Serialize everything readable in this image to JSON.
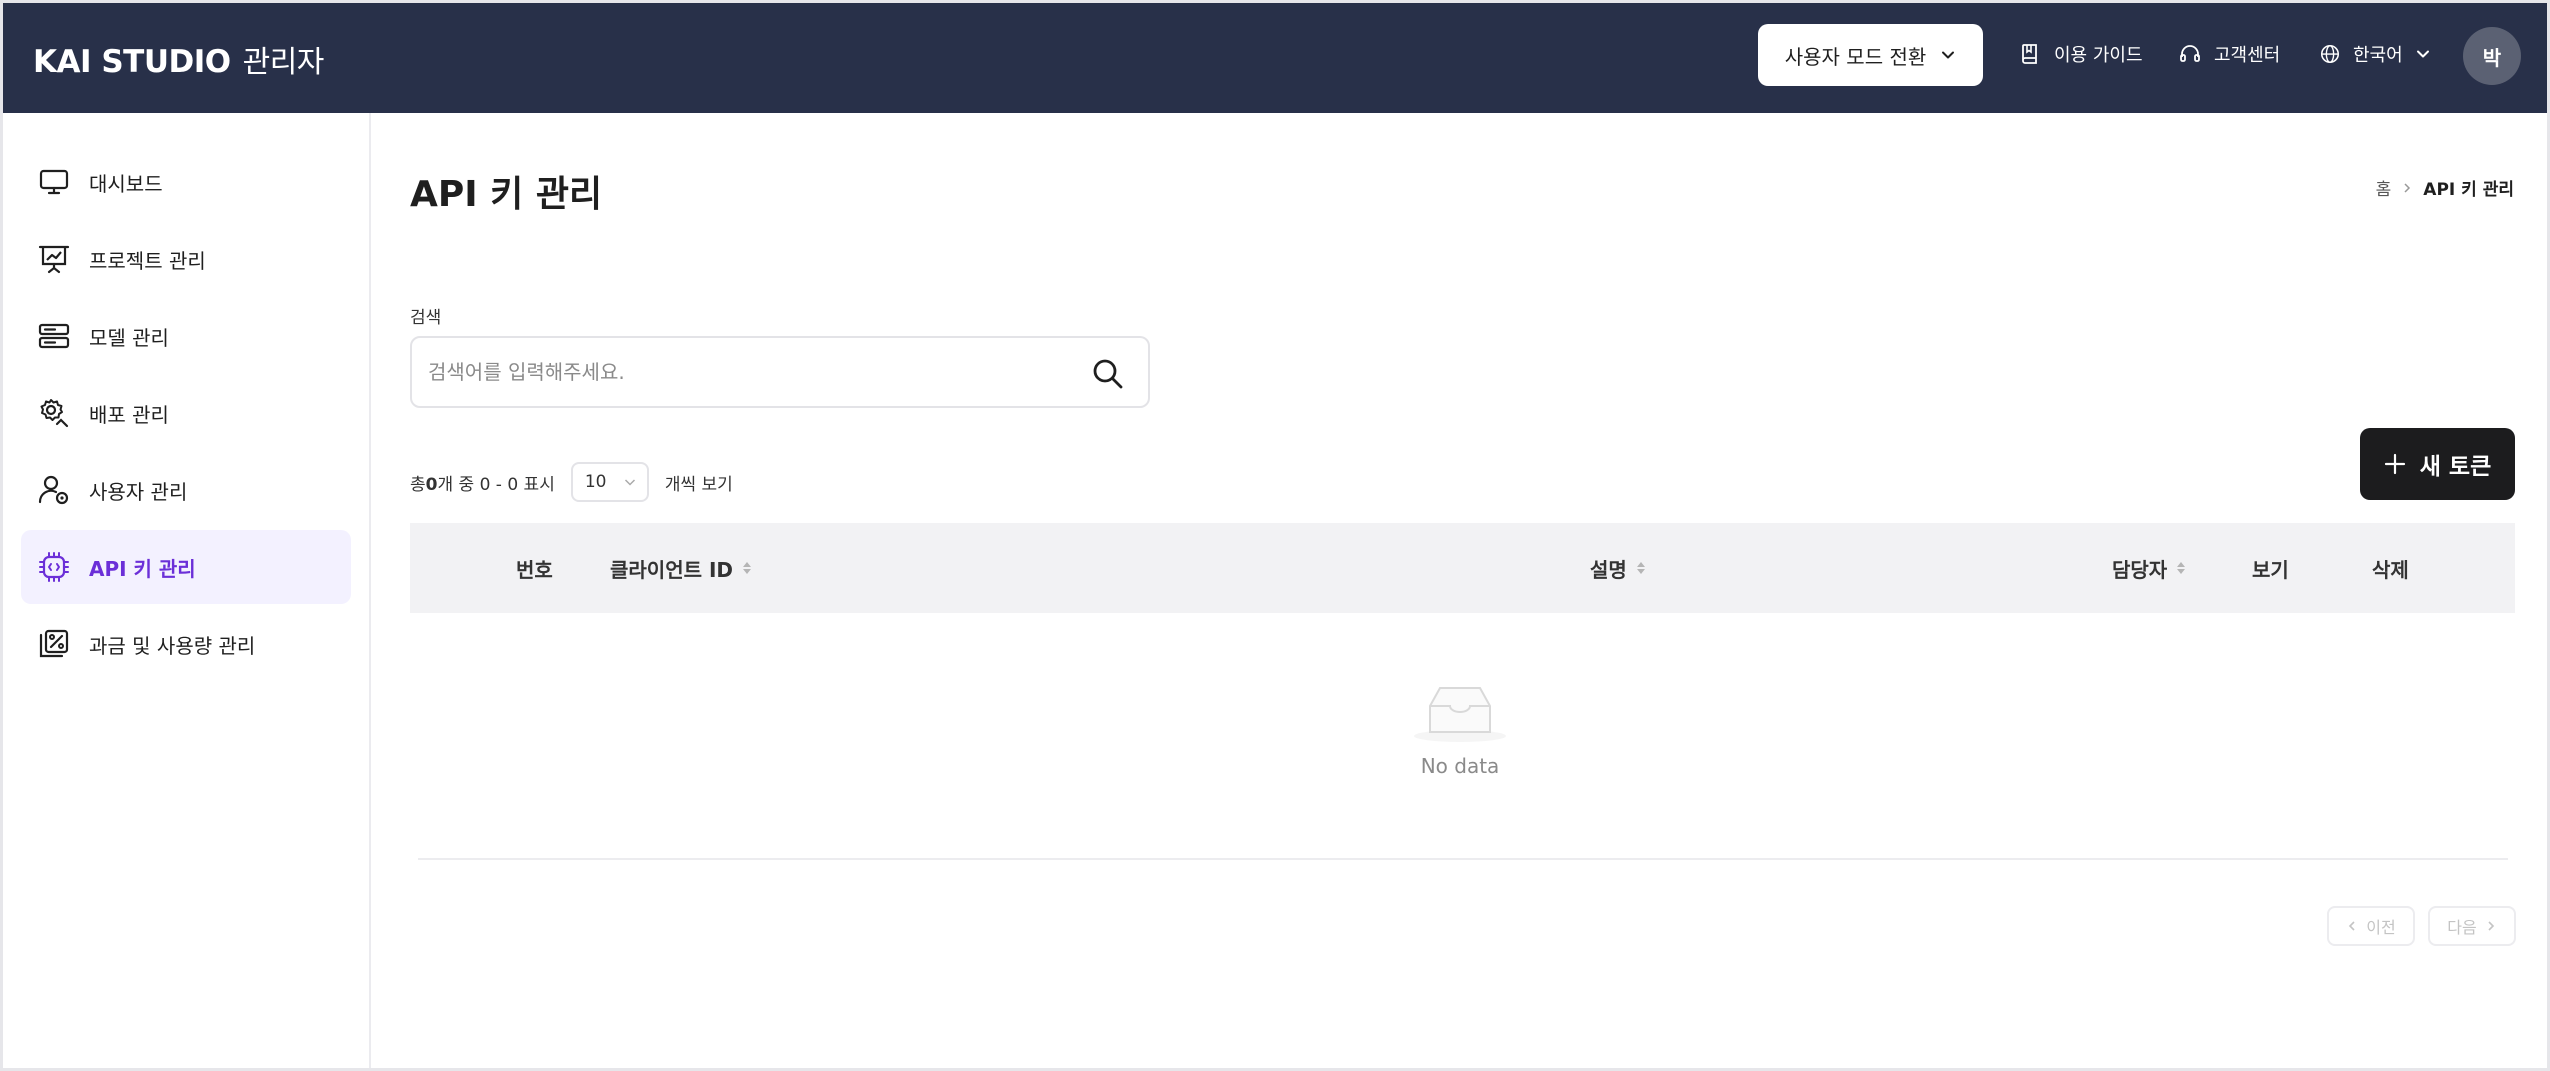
{
  "header": {
    "brand": "KAI STUDIO",
    "brand_sub": "관리자",
    "mode_switch": "사용자 모드 전환",
    "guide": "이용 가이드",
    "support": "고객센터",
    "language": "한국어",
    "avatar": "박"
  },
  "sidebar": {
    "items": [
      {
        "label": "대시보드",
        "icon": "monitor-icon"
      },
      {
        "label": "프로젝트 관리",
        "icon": "presentation-chart-icon"
      },
      {
        "label": "모델 관리",
        "icon": "server-icon"
      },
      {
        "label": "배포 관리",
        "icon": "gear-deploy-icon"
      },
      {
        "label": "사용자 관리",
        "icon": "user-gear-icon"
      },
      {
        "label": "API 키 관리",
        "icon": "api-chip-icon",
        "active": true
      },
      {
        "label": "과금 및 사용량 관리",
        "icon": "percent-chart-icon"
      }
    ]
  },
  "main": {
    "title": "API 키 관리",
    "breadcrumb": {
      "home": "홈",
      "current": "API 키 관리"
    },
    "search": {
      "label": "검색",
      "placeholder": "검색어를 입력해주세요.",
      "value": ""
    },
    "summary": {
      "prefix": "총",
      "total": "0",
      "suffix": "개 중 0 - 0 표시"
    },
    "page_size": "10",
    "page_size_suffix": "개씩 보기",
    "new_button": "새 토큰",
    "table": {
      "columns": [
        "번호",
        "클라이언트 ID",
        "설명",
        "담당자",
        "보기",
        "삭제"
      ],
      "empty_text": "No data"
    },
    "pagination": {
      "prev": "이전",
      "next": "다음"
    }
  },
  "colors": {
    "header_bg": "#283049",
    "accent": "#6b2fd8",
    "active_bg": "#f3f1ff",
    "primary_button": "#1c1c1e"
  }
}
